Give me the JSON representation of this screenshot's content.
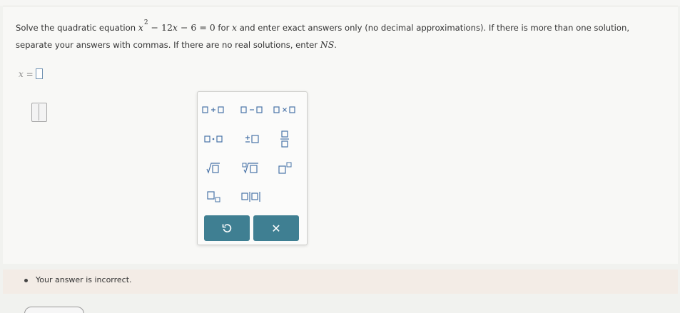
{
  "question": {
    "prefix": "Solve the quadratic equation ",
    "eq_x": "x",
    "eq_exp": "2",
    "eq_minus1": " − 12",
    "eq_x2": "x",
    "eq_rest": " − 6 = 0",
    "mid": " for ",
    "var": "x",
    "suffix": " and enter exact answers only (no decimal approximations). If there is more than one solution, separate your answers with commas. If there are no real solutions, enter ",
    "ns": "NS",
    "end": "."
  },
  "answer": {
    "label": "x ="
  },
  "keypad": {
    "undo_icon": "undo-icon",
    "clear_icon": "close-icon",
    "clear_label": "✕",
    "accent": "#3f7f92",
    "key_color": "#4a74a8"
  },
  "feedback": {
    "text": "Your answer is incorrect."
  }
}
